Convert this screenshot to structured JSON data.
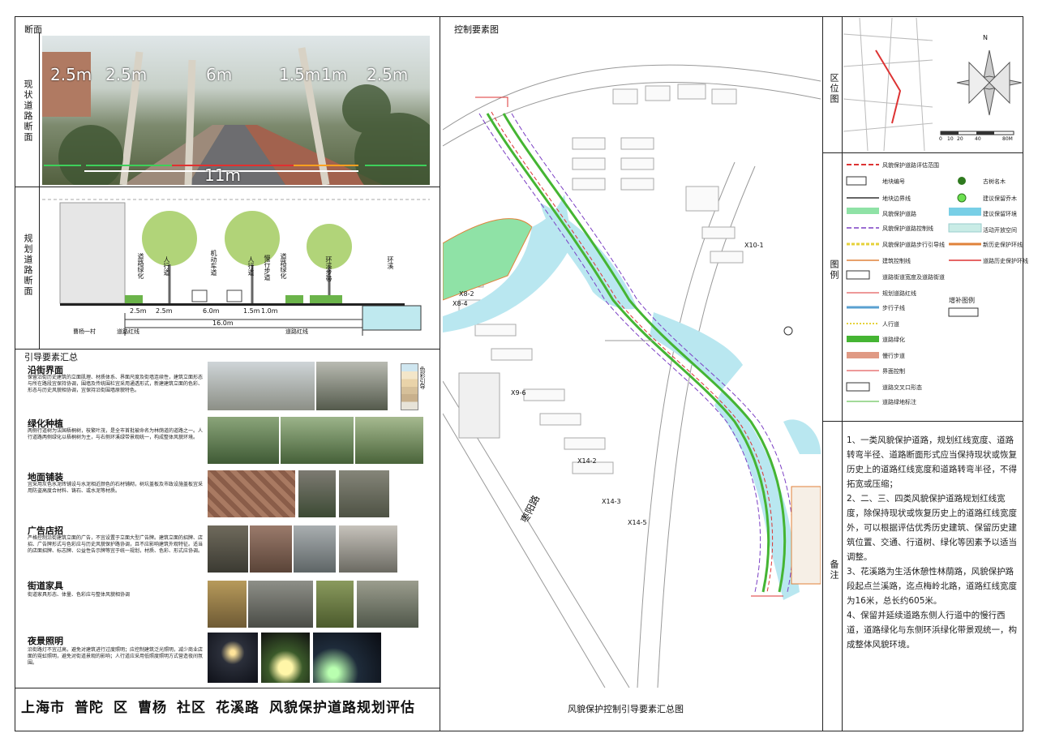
{
  "left": {
    "section_label": "断面",
    "current_section_label": "现状道路断面",
    "current_dims": [
      "2.5m",
      "2.5m",
      "6m",
      "1.5m",
      "1m",
      "2.5m"
    ],
    "current_total": "11m",
    "planned_section_label": "规划道路断面",
    "planned_tags": [
      "道路绿化",
      "人行道",
      "机动车道",
      "人行道",
      "慢行步道",
      "道路绿化",
      "环溪步带",
      "环溪"
    ],
    "planned_dims": [
      "2.5m",
      "2.5m",
      "6.0m",
      "1.5m",
      "1.0m"
    ],
    "planned_total": "16.0m",
    "planned_bottom": [
      "曹杨一村",
      "道路红线",
      "道路红线"
    ],
    "guide_title": "引导要素汇总",
    "guides": [
      {
        "title": "沿街界面",
        "text": "保留沿街历史建筑的立面肌理、材质体系、界面尺度及街墙连续性，建筑立面形态与所在路段宜保持协调，围墙及传统围栏宜采用通透形式，新建建筑立面的色彩、形态与历史风貌相协调，宜保持沿街围墙原貌特色。"
      },
      {
        "title": "绿化种植",
        "text": "两侧行道树为法国梧桐树，枝繁叶茂，是全市首批被命名为林荫道的道路之一。人行道路两侧绿化以梧桐树为主，与右侧环溪绿带景观统一，构成整体风貌环境。"
      },
      {
        "title": "地面铺装",
        "text": "宜采用灰色水泥砖铺设与水泥相近颜色的石材铺砌，树坑盖板及市政设施盖板宜采用防盗高度合材料、铸石、或水泥等材质。"
      },
      {
        "title": "广告店招",
        "text": "严格控制沿街建筑立面的广告，不宜设置于立面大型广告牌。建筑立面的招牌、店招、广告牌形式与色彩应与历史风貌保护路协调，且不应影响建筑外观特征。适当的店面招牌、标志牌、公益性告示牌等宜于统一规划，材质、色彩、形式应协调。"
      },
      {
        "title": "街道家具",
        "text": "街道家具形态、体量、色彩应与整体风貌相协调"
      },
      {
        "title": "夜景照明",
        "text": "沿街路灯不宜过高，避免对建筑进行过度照明；应控制建筑泛光照明，减少商业店面的霓虹照明，避免对街道景观的影响；人行道应采用低照度照明方式营造夜间氛围。"
      }
    ],
    "color_label": "色彩引导"
  },
  "map": {
    "title": "控制要素图",
    "road_name": "枣阳路",
    "parcels": [
      "X10-1",
      "X8-2",
      "X8-4",
      "X9-6",
      "X14-2",
      "X14-3",
      "X14-5"
    ]
  },
  "right": {
    "location_label": "区位图",
    "compass": "N",
    "scale_ticks": [
      "0",
      "10",
      "20",
      "40",
      "80M"
    ],
    "legend_label": "图例",
    "legend_left": [
      "风貌保护道路评估范围",
      "地块编号",
      "地块边界线",
      "风貌保护道路",
      "风貌保护道路控制线",
      "风貌保护道路步行引导线",
      "建筑控制线",
      "道路街道宽度及道路街道",
      "规划道路红线",
      "步行子线",
      "人行道",
      "道路绿化",
      "慢行步道",
      "界面控制",
      "道路交叉口形态",
      "道路绿地标注"
    ],
    "legend_right": [
      "古树名木",
      "建议保留乔木",
      "建议保留环境",
      "活动开放空间",
      "新历史保护环线",
      "道路历史保护环线",
      "增补图例"
    ],
    "notes_label": "备注",
    "notes": [
      "1、一类风貌保护道路，规划红线宽度、道路转弯半径、道路断面形式应当保持现状或恢复历史上的道路红线宽度和道路转弯半径，不得拓宽或压缩；",
      "2、二、三、四类风貌保护道路规划红线宽度，除保持现状或恢复历史上的道路红线宽度外，可以根据评估优秀历史建筑、保留历史建筑位置、交通、行道树、绿化等因素予以适当调整。",
      "3、花溪路为生活休憩性林荫路，风貌保护路段起点兰溪路，迄点梅岭北路，道路红线宽度为16米，总长约605米。",
      "4、保留并延续道路东侧人行道中的慢行西道，道路绿化与东侧环浜绿化带景观统一，构成整体风貌环境。"
    ]
  },
  "footer": {
    "title_parts": [
      "上海市",
      "普陀",
      "区",
      "曹杨",
      "社区",
      "花溪路",
      "风貌保护道路规划评估"
    ],
    "subtitle": "风貌保护控制引导要素汇总图"
  }
}
